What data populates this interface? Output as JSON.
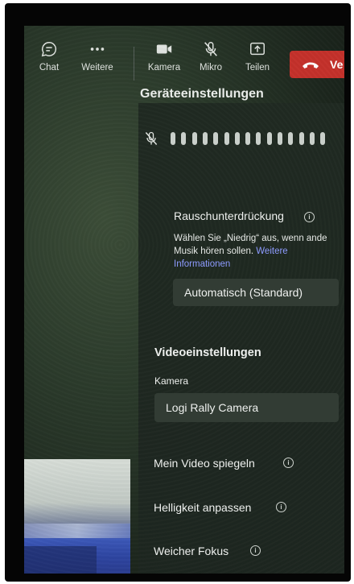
{
  "toolbar": {
    "chat_label": "Chat",
    "more_label": "Weitere",
    "camera_label": "Kamera",
    "mic_label": "Mikro",
    "share_label": "Teilen",
    "leave_label": "Ve",
    "leave_color": "#c4312b"
  },
  "panel": {
    "title": "Geräteeinstellungen",
    "mic_level_bars": 15,
    "noise": {
      "title": "Rauschunterdrückung",
      "desc_text": "Wählen Sie „Niedrig“ aus, wenn ande Musik hören sollen.",
      "desc_link": "Weitere Informationen",
      "selected": "Automatisch (Standard)"
    },
    "video": {
      "title": "Videoeinstellungen",
      "camera_label": "Kamera",
      "camera_selected": "Logi Rally Camera",
      "mirror_label": "Mein Video spiegeln",
      "brightness_label": "Helligkeit anpassen",
      "soft_focus_label": "Weicher Fokus"
    }
  },
  "colors": {
    "link": "#8d9bff",
    "panel_bg": "#1d2620"
  }
}
